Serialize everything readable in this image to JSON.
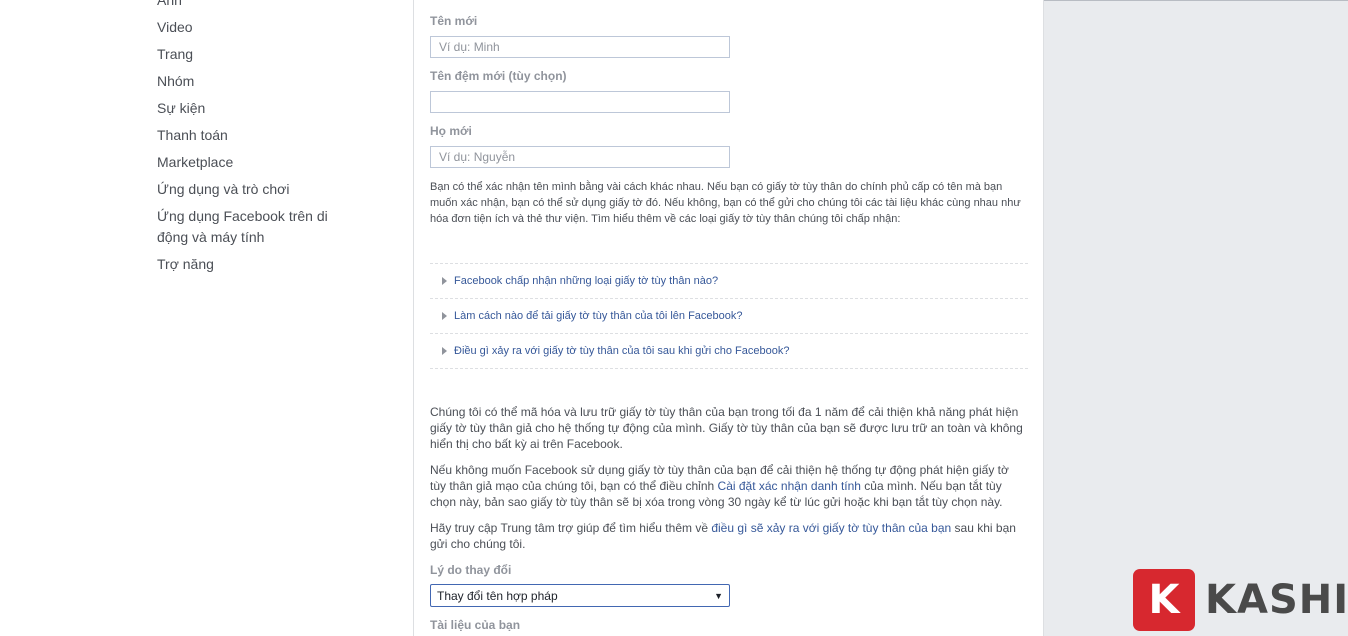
{
  "sidebar": {
    "items": [
      {
        "label": "Ảnh"
      },
      {
        "label": "Video"
      },
      {
        "label": "Trang"
      },
      {
        "label": "Nhóm"
      },
      {
        "label": "Sự kiện"
      },
      {
        "label": "Thanh toán"
      },
      {
        "label": "Marketplace"
      },
      {
        "label": "Ứng dụng và trò chơi"
      },
      {
        "label": "Ứng dụng Facebook trên di động và máy tính"
      },
      {
        "label": "Trợ năng"
      }
    ]
  },
  "form": {
    "first_name": {
      "label": "Tên mới",
      "placeholder": "Ví dụ: Minh",
      "value": ""
    },
    "middle_name": {
      "label": "Tên đệm mới (tùy chọn)",
      "placeholder": "",
      "value": ""
    },
    "last_name": {
      "label": "Họ mới",
      "placeholder": "Ví dụ: Nguyễn",
      "value": ""
    },
    "intro": "Bạn có thể xác nhận tên mình bằng vài cách khác nhau. Nếu bạn có giấy tờ tùy thân do chính phủ cấp có tên mà bạn muốn xác nhận, bạn có thể sử dụng giấy tờ đó. Nếu không, bạn có thể gửi cho chúng tôi các tài liệu khác cùng nhau như hóa đơn tiện ích và thẻ thư viện. Tìm hiểu thêm về các loại giấy tờ tùy thân chúng tôi chấp nhận:",
    "faq": [
      {
        "label": "Facebook chấp nhận những loại giấy tờ tùy thân nào?"
      },
      {
        "label": "Làm cách nào để tải giấy tờ tùy thân của tôi lên Facebook?"
      },
      {
        "label": "Điều gì xảy ra với giấy tờ tùy thân của tôi sau khi gửi cho Facebook?"
      }
    ],
    "para1": "Chúng tôi có thể mã hóa và lưu trữ giấy tờ tùy thân của bạn trong tối đa 1 năm để cải thiện khả năng phát hiện giấy tờ tùy thân giả cho hệ thống tự động của mình. Giấy tờ tùy thân của bạn sẽ được lưu trữ an toàn và không hiển thị cho bất kỳ ai trên Facebook.",
    "para2": {
      "before": "Nếu không muốn Facebook sử dụng giấy tờ tùy thân của bạn để cải thiện hệ thống tự động phát hiện giấy tờ tùy thân giả mạo của chúng tôi, bạn có thể điều chỉnh ",
      "link": "Cài đặt xác nhận danh tính",
      "after": " của mình. Nếu bạn tắt tùy chọn này, bản sao giấy tờ tùy thân sẽ bị xóa trong vòng 30 ngày kể từ lúc gửi hoặc khi bạn tắt tùy chọn này."
    },
    "para3": {
      "before": "Hãy truy cập Trung tâm trợ giúp để tìm hiểu thêm về ",
      "link": "điều gì sẽ xảy ra với giấy tờ tùy thân của bạn",
      "after": " sau khi bạn gửi cho chúng tôi."
    },
    "reason": {
      "label": "Lý do thay đổi",
      "selected": "Thay đổi tên hợp pháp"
    },
    "documents_label": "Tài liệu của bạn"
  },
  "watermark": {
    "letter": "K",
    "text": "KASHI",
    "color": "#d7282f"
  }
}
